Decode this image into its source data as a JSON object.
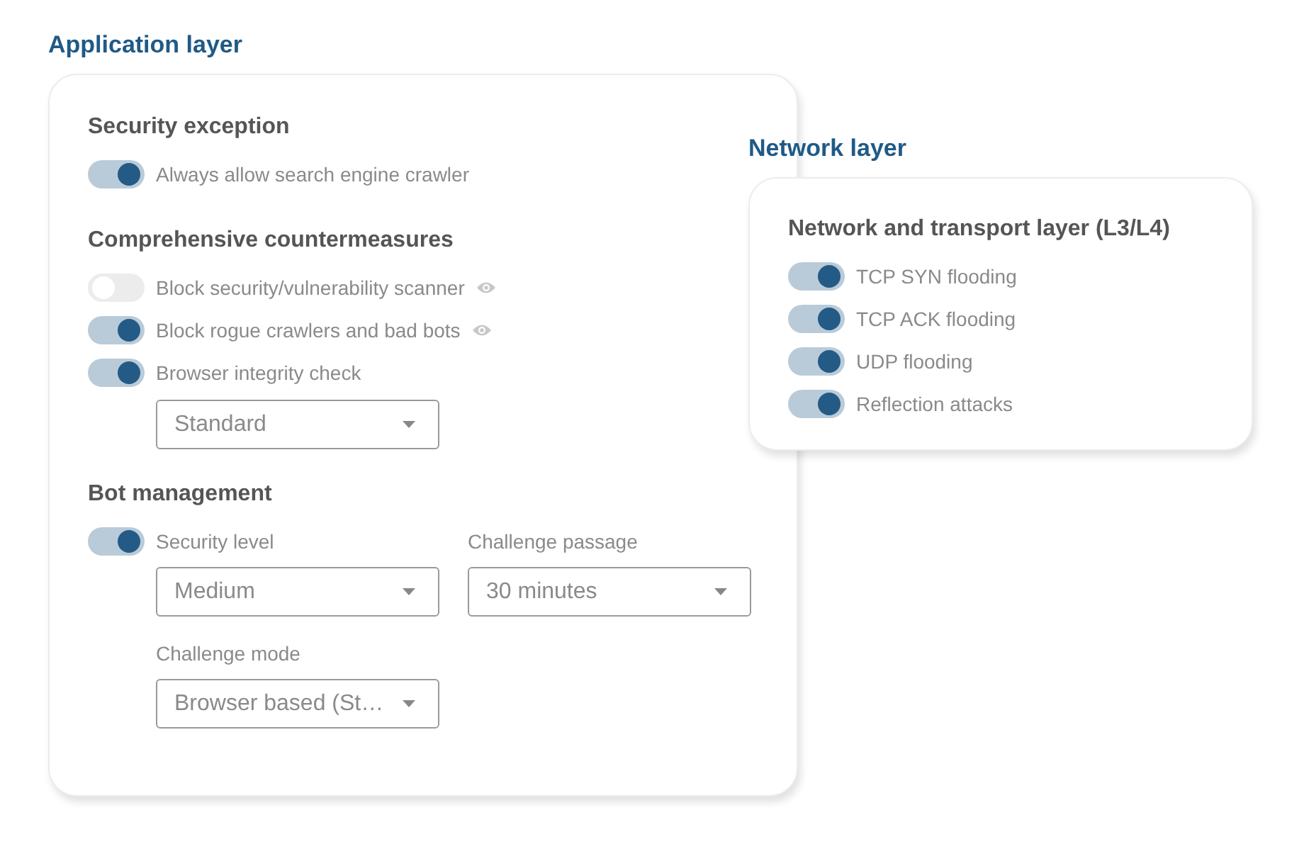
{
  "application_layer": {
    "title": "Application layer",
    "sections": [
      {
        "heading": "Security exception",
        "rows": [
          {
            "kind": "toggle",
            "label": "Always allow search engine crawler",
            "on": true,
            "eye_icon": false
          }
        ]
      },
      {
        "heading": "Comprehensive countermeasures",
        "rows": [
          {
            "kind": "toggle",
            "label": "Block security/vulnerability scanner",
            "on": false,
            "eye_icon": true
          },
          {
            "kind": "toggle",
            "label": "Block rogue crawlers and bad bots",
            "on": true,
            "eye_icon": true
          },
          {
            "kind": "toggle",
            "label": "Browser integrity check",
            "on": true,
            "eye_icon": false
          },
          {
            "kind": "select",
            "value": "Standard"
          }
        ]
      },
      {
        "heading": "Bot management",
        "rows": [
          {
            "kind": "toggle_fields",
            "on": true,
            "fields": [
              {
                "label": "Security level",
                "value": "Medium"
              },
              {
                "label": "Challenge passage",
                "value": "30 minutes"
              },
              {
                "label": "Challenge mode",
                "value": "Browser based (St…"
              }
            ]
          }
        ]
      }
    ]
  },
  "network_layer": {
    "title": "Network layer",
    "heading": "Network and transport layer (L3/L4)",
    "rows": [
      {
        "label": "TCP SYN flooding",
        "on": true
      },
      {
        "label": "TCP ACK flooding",
        "on": true
      },
      {
        "label": "UDP flooding",
        "on": true
      },
      {
        "label": "Reflection attacks",
        "on": true
      }
    ]
  }
}
